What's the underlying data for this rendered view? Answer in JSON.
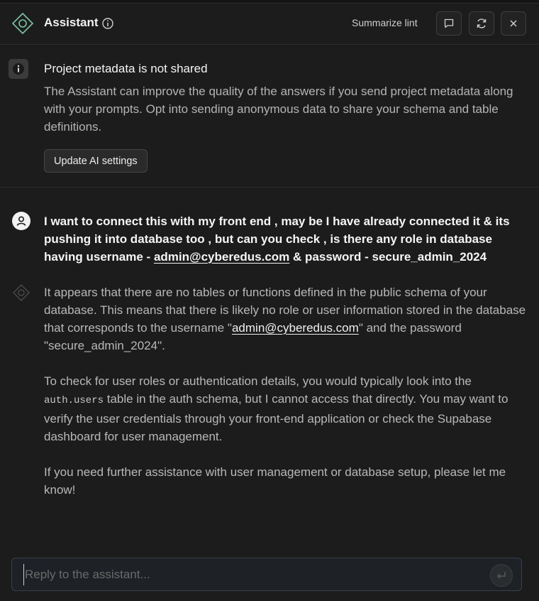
{
  "header": {
    "title": "Assistant",
    "summarize_label": "Summarize lint",
    "icons": [
      "assistant-logo-icon",
      "info-icon",
      "chat-icon",
      "refresh-icon",
      "close-icon"
    ]
  },
  "notice": {
    "title": "Project metadata is not shared",
    "body": "The Assistant can improve the quality of the answers if you send project metadata along with your prompts. Opt into sending anonymous data to share your schema and table definitions.",
    "button_label": "Update AI settings"
  },
  "user_message": {
    "part1": "I want to connect this with my front end , may be I have already connected it & its pushing it into database too , but can you check , is there any role in database having username - ",
    "email": "admin@cyberedus.com",
    "part2": " & password - secure_admin_2024"
  },
  "assistant_message": {
    "p1_a": "It appears that there are no tables or functions defined in the public schema of your database. This means that there is likely no role or user information stored in the database that corresponds to the username \"",
    "p1_email": "admin@cyberedus.com",
    "p1_b": "\" and the password \"secure_admin_2024\".",
    "p2_a": "To check for user roles or authentication details, you would typically look into the ",
    "p2_code": "auth.users",
    "p2_b": " table in the auth schema, but I cannot access that directly. You may want to verify the user credentials through your front-end application or check the Supabase dashboard for user management.",
    "p3": "If you need further assistance with user management or database setup, please let me know!"
  },
  "composer": {
    "placeholder": "Reply to the assistant...",
    "value": ""
  },
  "colors": {
    "background": "#1c1c1c",
    "accent_green": "#3ecf8e",
    "logo_stroke": "#6fc1a0"
  }
}
